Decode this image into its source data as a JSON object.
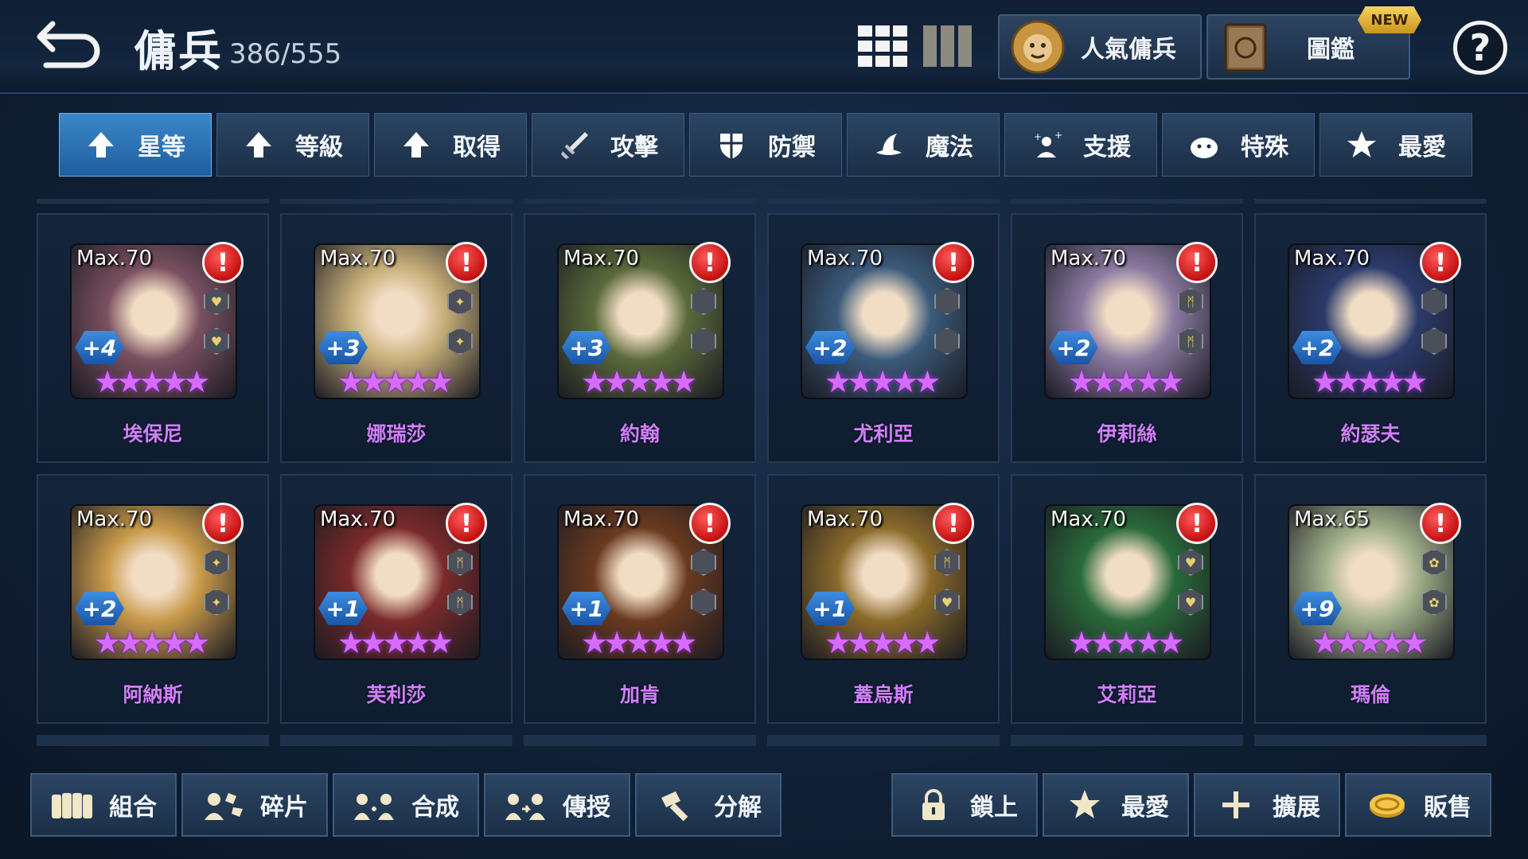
{
  "header": {
    "title": "傭兵",
    "count": "386/555",
    "popular_label": "人氣傭兵",
    "codex_label": "圖鑑",
    "new_badge": "NEW",
    "help_label": "?"
  },
  "tabs": [
    {
      "label": "星等",
      "icon": "arrow-up-icon",
      "active": true
    },
    {
      "label": "等級",
      "icon": "arrow-up-icon",
      "active": false
    },
    {
      "label": "取得",
      "icon": "arrow-up-icon",
      "active": false
    },
    {
      "label": "攻擊",
      "icon": "sword-icon",
      "active": false
    },
    {
      "label": "防禦",
      "icon": "shield-icon",
      "active": false
    },
    {
      "label": "魔法",
      "icon": "magic-hat-icon",
      "active": false
    },
    {
      "label": "支援",
      "icon": "support-icon",
      "active": false
    },
    {
      "label": "特殊",
      "icon": "special-icon",
      "active": false
    },
    {
      "label": "最愛",
      "icon": "star-icon",
      "active": false
    }
  ],
  "mercenaries": [
    {
      "name": "埃保尼",
      "max": "Max.70",
      "plus": "+4",
      "stars": 5,
      "alert": "!",
      "color": "#7a5060",
      "gems": [
        "heart",
        "heart"
      ]
    },
    {
      "name": "娜瑞莎",
      "max": "Max.70",
      "plus": "+3",
      "stars": 5,
      "alert": "!",
      "color": "#c8b07a",
      "gems": [
        "rune",
        "rune"
      ]
    },
    {
      "name": "約翰",
      "max": "Max.70",
      "plus": "+3",
      "stars": 5,
      "alert": "!",
      "color": "#5a6a3a",
      "gems": [
        "",
        ""
      ]
    },
    {
      "name": "尤利亞",
      "max": "Max.70",
      "plus": "+2",
      "stars": 5,
      "alert": "!",
      "color": "#3a5a7a",
      "gems": [
        "",
        ""
      ]
    },
    {
      "name": "伊莉絲",
      "max": "Max.70",
      "plus": "+2",
      "stars": 5,
      "alert": "!",
      "color": "#8a7aa0",
      "gems": [
        "mark",
        "mark"
      ]
    },
    {
      "name": "約瑟夫",
      "max": "Max.70",
      "plus": "+2",
      "stars": 5,
      "alert": "!",
      "color": "#2a3a6a",
      "gems": [
        "",
        ""
      ]
    },
    {
      "name": "阿納斯",
      "max": "Max.70",
      "plus": "+2",
      "stars": 5,
      "alert": "!",
      "color": "#c89a4a",
      "gems": [
        "rune",
        "rune"
      ]
    },
    {
      "name": "芙利莎",
      "max": "Max.70",
      "plus": "+1",
      "stars": 5,
      "alert": "!",
      "color": "#7a2a2a",
      "gems": [
        "mark",
        "mark"
      ]
    },
    {
      "name": "加肯",
      "max": "Max.70",
      "plus": "+1",
      "stars": 5,
      "alert": "!",
      "color": "#6a3a1e",
      "gems": [
        "",
        ""
      ]
    },
    {
      "name": "蓋烏斯",
      "max": "Max.70",
      "plus": "+1",
      "stars": 5,
      "alert": "!",
      "color": "#8a6a2a",
      "gems": [
        "mark",
        "heart"
      ]
    },
    {
      "name": "艾莉亞",
      "max": "Max.70",
      "plus": "",
      "stars": 5,
      "alert": "!",
      "color": "#2a6a3a",
      "gems": [
        "heart",
        "heart"
      ]
    },
    {
      "name": "瑪倫",
      "max": "Max.65",
      "plus": "+9",
      "stars": 5,
      "alert": "!",
      "color": "#a0b08a",
      "gems": [
        "flower",
        "flower"
      ]
    }
  ],
  "bottom": {
    "combine": "組合",
    "fragments": "碎片",
    "synthesize": "合成",
    "transfer": "傳授",
    "dismantle": "分解",
    "lock": "鎖上",
    "favorite": "最愛",
    "expand": "擴展",
    "sell": "販售"
  },
  "colors": {
    "accent": "#3b86c8",
    "name": "#d080ff",
    "star": "#d86bff",
    "alert": "#d11a1a"
  }
}
